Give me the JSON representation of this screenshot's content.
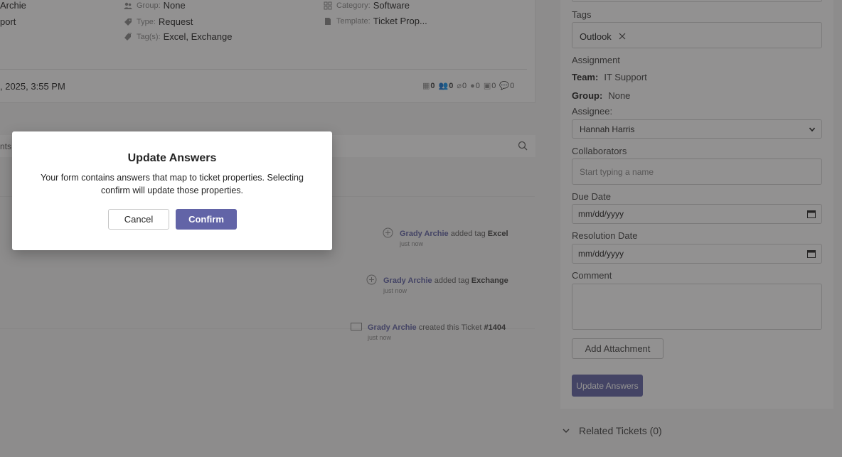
{
  "ticket": {
    "requester_fragment": "Archie",
    "team_fragment": "port",
    "group": {
      "label": "Group:",
      "value": "None"
    },
    "type": {
      "label": "Type:",
      "value": "Request"
    },
    "tags": {
      "label": "Tag(s):",
      "value": "Excel, Exchange"
    },
    "category": {
      "label": "Category:",
      "value": "Software"
    },
    "template": {
      "label": "Template:",
      "value": "Ticket Prop..."
    },
    "created_date": ", 2025, 3:55 PM",
    "counters": [
      "0",
      "0",
      "0",
      "0",
      "0",
      "0"
    ]
  },
  "feed": {
    "search_fragment": "nts",
    "activities": [
      {
        "who": "Grady Archie",
        "action": "added tag",
        "target": "Excel",
        "when": "just now",
        "icon": "plus-circle-icon"
      },
      {
        "who": "Grady Archie",
        "action": "added tag",
        "target": "Exchange",
        "when": "just now",
        "icon": "plus-circle-icon"
      },
      {
        "who": "Grady Archie",
        "action": "created this Ticket",
        "target": "#1404",
        "when": "just now",
        "icon": "ticket-icon"
      }
    ]
  },
  "sidebar": {
    "tags_label": "Tags",
    "tag_chip": "Outlook",
    "assignment_label": "Assignment",
    "team_key": "Team:",
    "team_value": "IT Support",
    "group_key": "Group:",
    "group_value": "None",
    "assignee_label": "Assignee:",
    "assignee_value": "Hannah Harris",
    "collaborators_label": "Collaborators",
    "collaborators_placeholder": "Start typing a name",
    "due_label": "Due Date",
    "due_placeholder": "mm/dd/yyyy",
    "resolution_label": "Resolution Date",
    "resolution_placeholder": "mm/dd/yyyy",
    "comment_label": "Comment",
    "add_attachment": "Add Attachment",
    "update_answers": "Update Answers",
    "related_tickets": "Related Tickets (0)"
  },
  "dialog": {
    "title": "Update Answers",
    "body": "Your form contains answers that map to ticket properties. Selecting confirm will update those properties.",
    "cancel": "Cancel",
    "confirm": "Confirm"
  },
  "colors": {
    "accent": "#6264a7",
    "overlay": "rgba(37,36,36,0.5)"
  }
}
